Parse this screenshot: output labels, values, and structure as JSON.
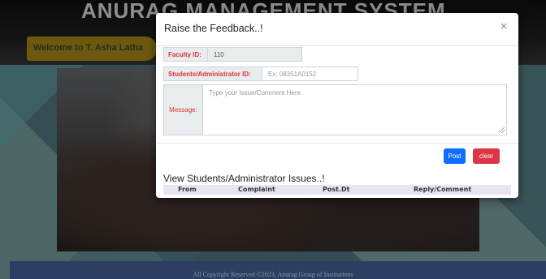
{
  "site": {
    "title": "ANURAG MANAGEMENT SYSTEM",
    "welcome": "Welcome to T. Asha Latha",
    "footer": "All Copyright Reserved ©2023, Anurag Group of Institutions"
  },
  "modal": {
    "title": "Raise the Feedback..!",
    "close_symbol": "×",
    "faculty_id_label": "Faculty ID:",
    "faculty_id_value": "110",
    "student_id_label": "Students/Administrator ID:",
    "student_id_placeholder": "Ex: 08351A0152",
    "message_label": "Message:",
    "message_placeholder": "Type your Issue/Comment Here.",
    "post_label": "Post",
    "clear_label": "clear"
  },
  "issues": {
    "title": "View Students/Administrator Issues..!",
    "columns": [
      "From",
      "Complaint",
      "Post.Dt",
      "Reply/Comment"
    ]
  },
  "colors": {
    "primary": "#0d6efd",
    "danger": "#dc3545",
    "label_red": "#dd3333",
    "footer_bar": "#2c3f63"
  }
}
